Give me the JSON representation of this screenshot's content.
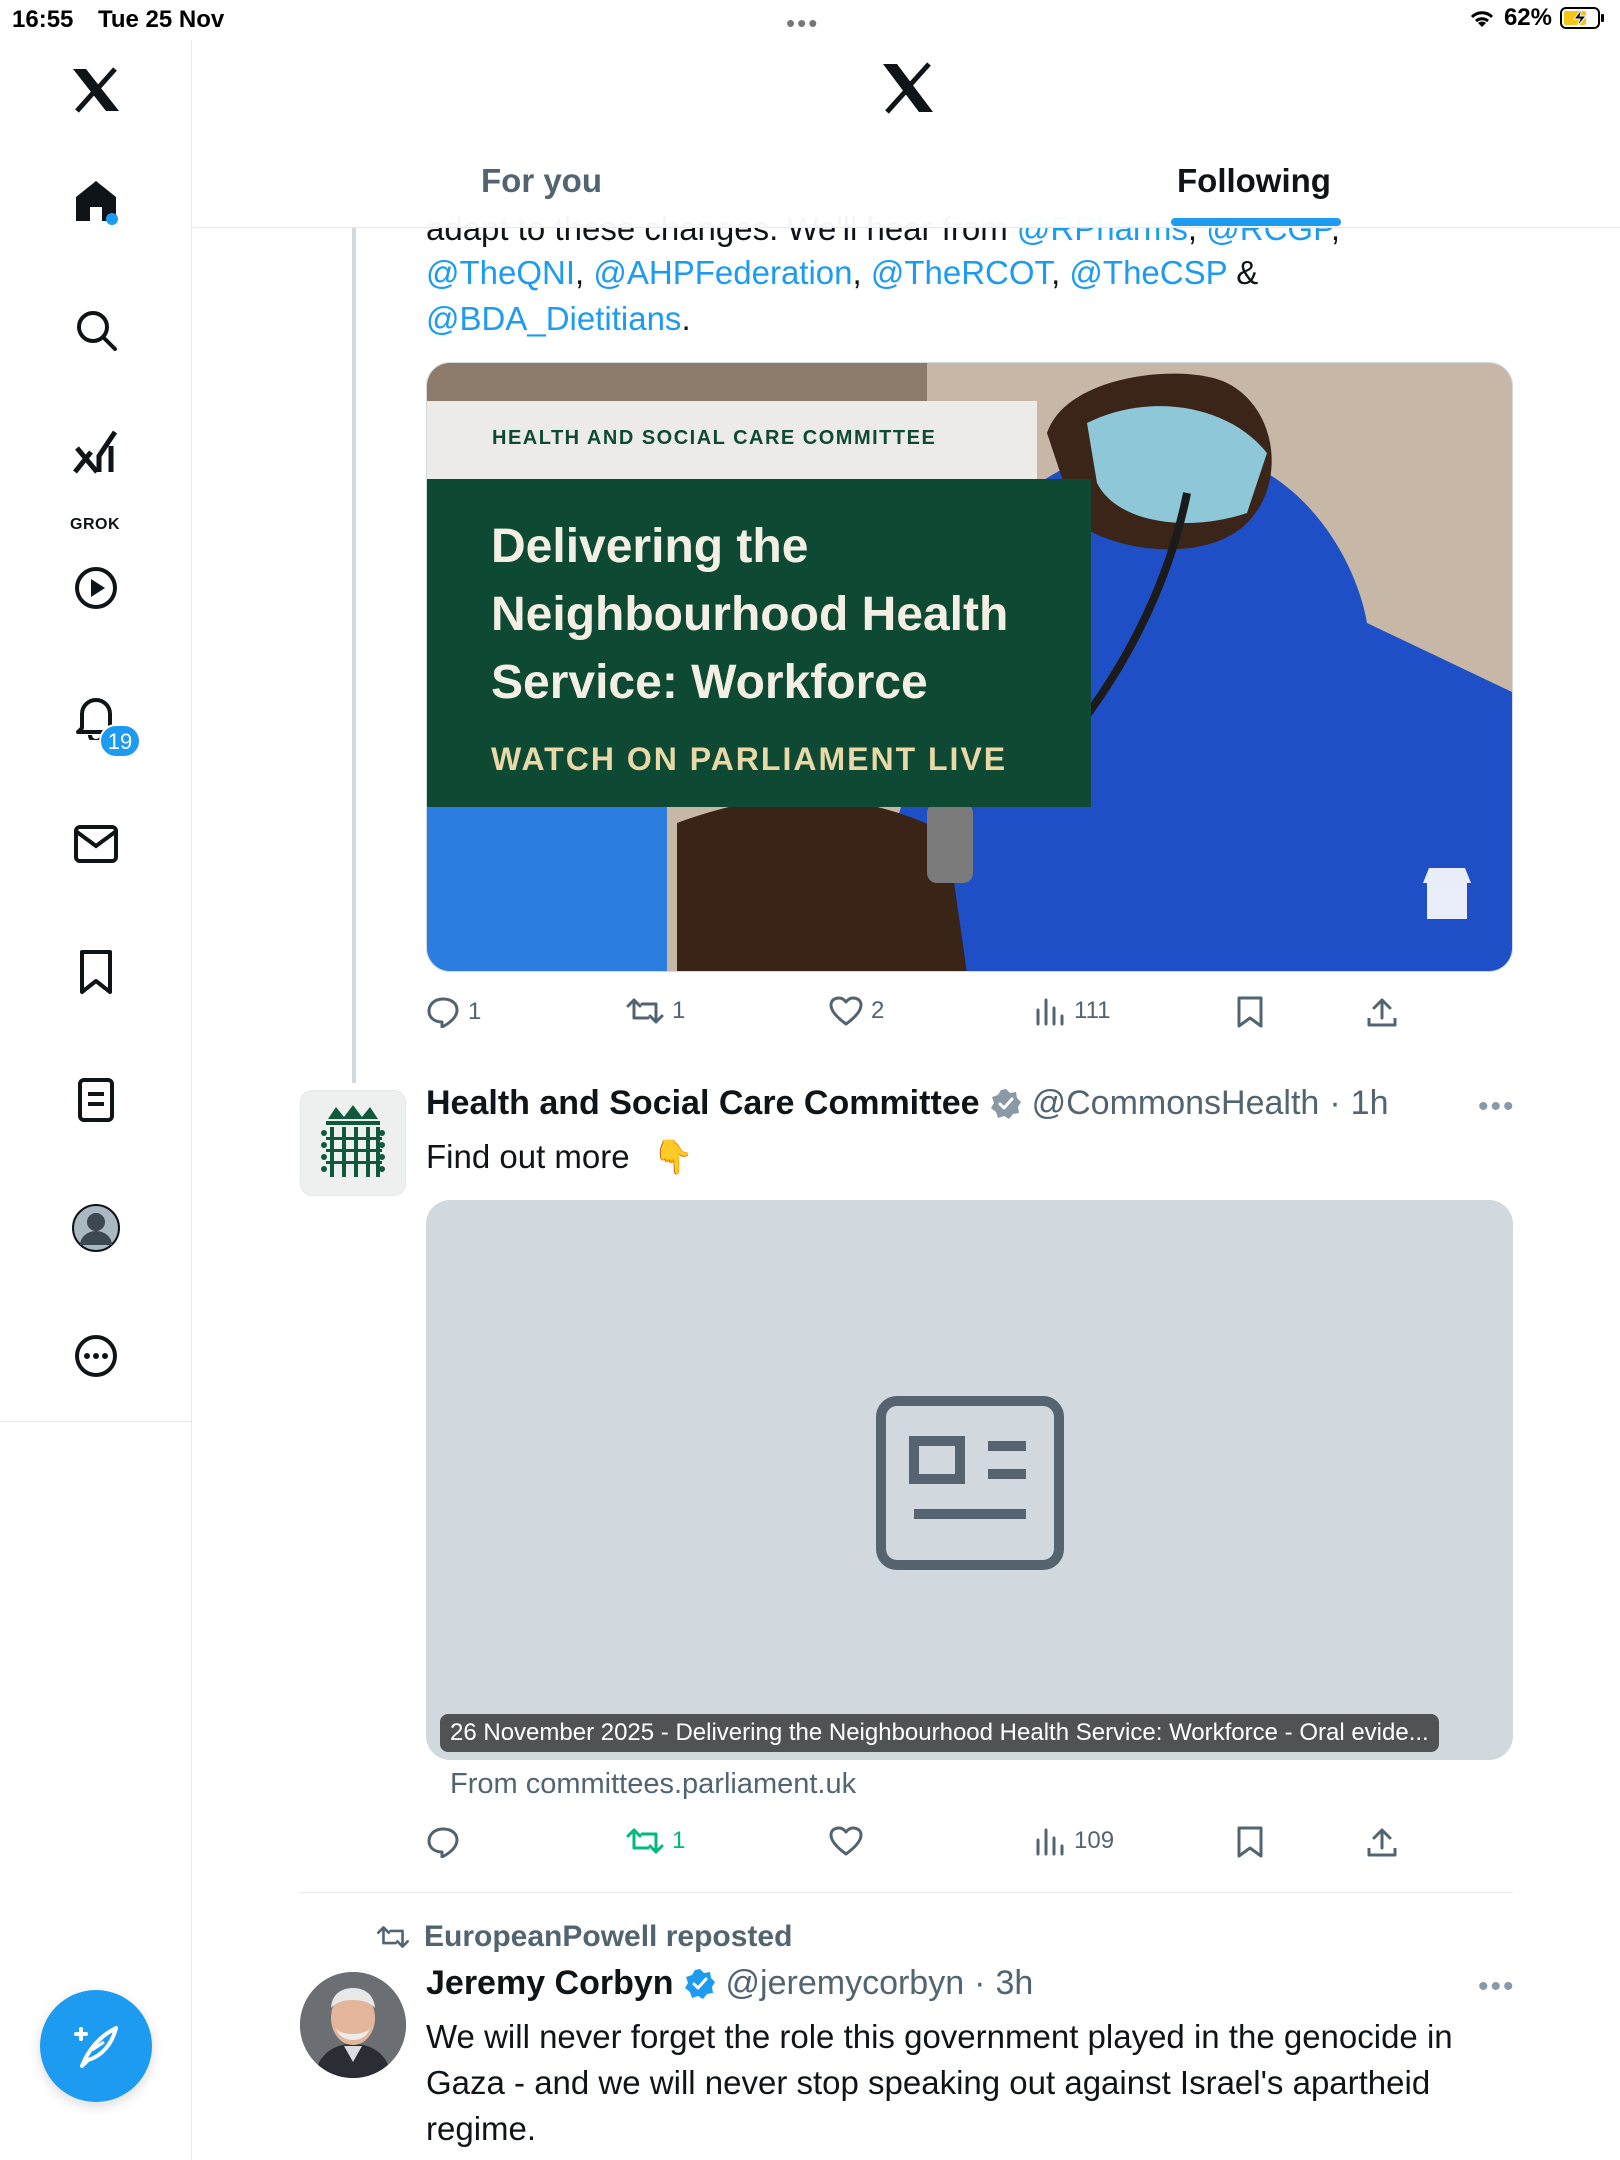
{
  "status_bar": {
    "time": "16:55",
    "date": "Tue 25 Nov",
    "battery": "62%"
  },
  "nav": {
    "grok_label": "GROK",
    "notifications_count": "19"
  },
  "header": {
    "tabs": [
      {
        "label": "For you"
      },
      {
        "label": "Following"
      }
    ]
  },
  "tweet1": {
    "text_clipped": "adapt to these changes. We'll hear from",
    "mentions_clipped": [
      "@RPharms",
      "@RCGP"
    ],
    "mentions": [
      "@TheQNI",
      "@AHPFederation",
      "@TheRCOT",
      "@TheCSP",
      "@BDA_Dietitians"
    ],
    "amp": "&",
    "media": {
      "banner_label": "HEALTH AND SOCIAL CARE COMMITTEE",
      "title": "Delivering the Neighbourhood Health Service: Workforce",
      "cta": "WATCH ON PARLIAMENT LIVE"
    },
    "replies": "1",
    "reposts": "1",
    "likes": "2",
    "views": "111"
  },
  "tweet2": {
    "name": "Health and Social Care Committee",
    "handle": "@CommonsHealth",
    "time": "1h",
    "text": "Find out more",
    "emoji": "👇",
    "card_caption": "26 November 2025 - Delivering the Neighbourhood Health Service: Workforce - Oral evide...",
    "card_from": "From committees.parliament.uk",
    "replies": "",
    "reposts": "1",
    "likes": "",
    "views": "109"
  },
  "tweet3": {
    "reposted_by": "EuropeanPowell reposted",
    "name": "Jeremy Corbyn",
    "handle": "@jeremycorbyn",
    "time": "3h",
    "text": "We will never forget the role this government played in the genocide in Gaza - and we will never stop speaking out against Israel's apartheid regime."
  },
  "colors": {
    "accent": "#1d9bf0",
    "repost_green": "#00ba7c",
    "committee_green": "#0e4a33"
  }
}
